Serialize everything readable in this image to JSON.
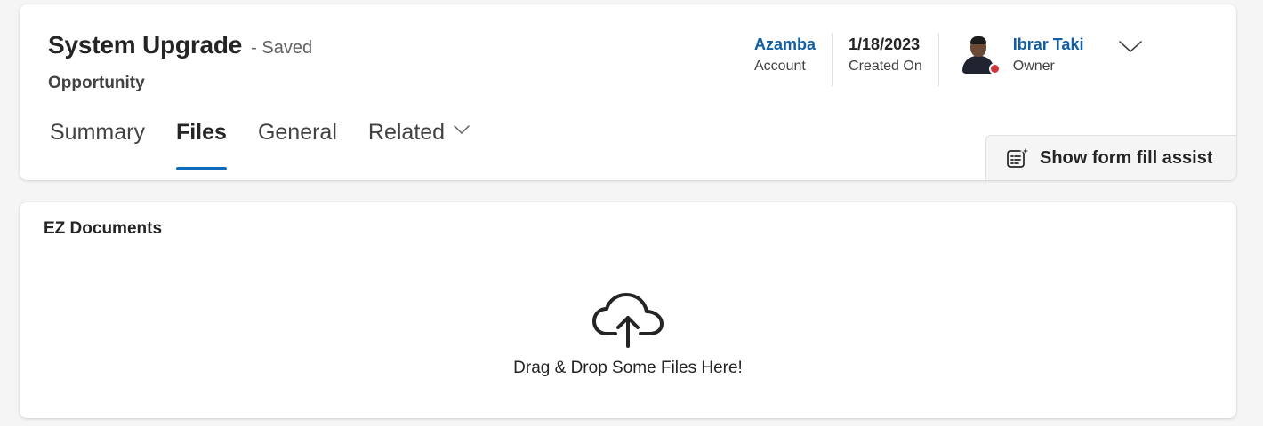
{
  "record": {
    "title": "System Upgrade",
    "save_status": "- Saved",
    "entity_type": "Opportunity"
  },
  "header_fields": {
    "account": {
      "value": "Azamba",
      "label": "Account"
    },
    "created_on": {
      "value": "1/18/2023",
      "label": "Created On"
    },
    "owner": {
      "value": "Ibrar Taki",
      "label": "Owner",
      "presence": "busy"
    }
  },
  "tabs": [
    {
      "label": "Summary",
      "active": false
    },
    {
      "label": "Files",
      "active": true
    },
    {
      "label": "General",
      "active": false
    },
    {
      "label": "Related",
      "active": false
    }
  ],
  "form_fill_assist": {
    "label": "Show form fill assist",
    "icon": "form-sparkle-icon"
  },
  "documents": {
    "title": "EZ Documents",
    "dropzone_text": "Drag & Drop Some Files Here!",
    "icon": "cloud-upload-icon"
  },
  "colors": {
    "link": "#115ea3",
    "tab_indicator": "#0f6cbd",
    "presence_busy": "#d13438",
    "page_background": "#f5f5f5"
  }
}
